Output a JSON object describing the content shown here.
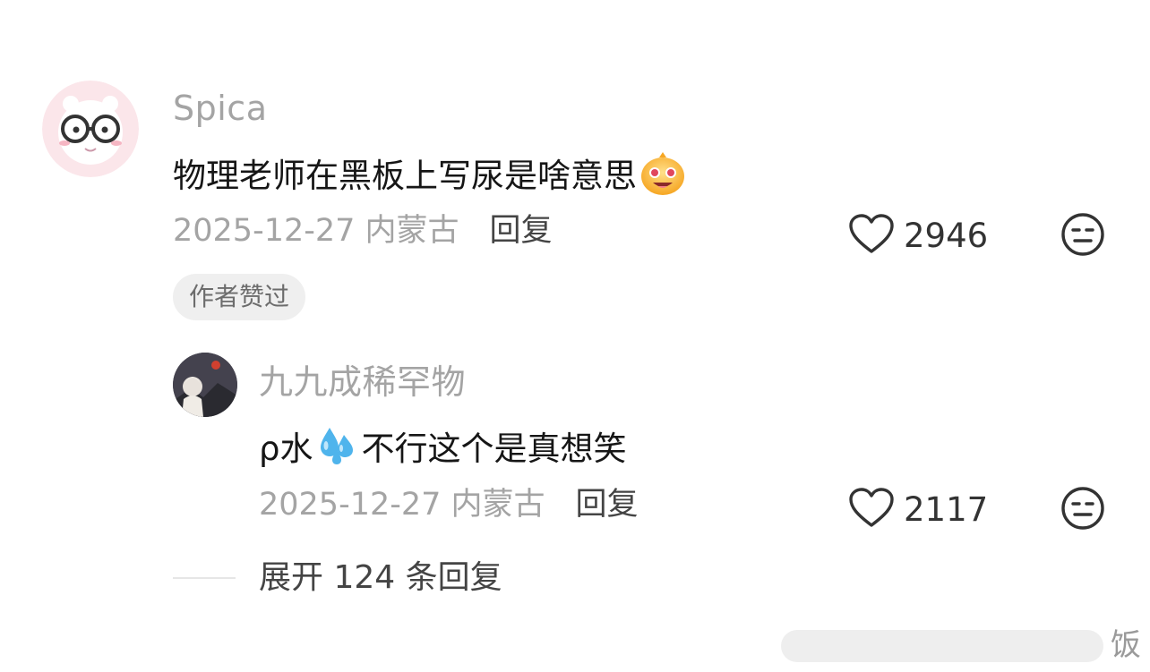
{
  "comment": {
    "username": "Spica",
    "text": "物理老师在黑板上写尿是啥意思",
    "emoji": "drooling-face-emoji",
    "date_location": "2025-12-27 内蒙古",
    "reply_label": "回复",
    "likes": "2946",
    "badge": "作者赞过"
  },
  "reply": {
    "username": "九九成稀罕物",
    "text_prefix": "ρ水",
    "emoji": "sweat-droplets-emoji",
    "text_suffix": "不行这个是真想笑",
    "date_location": "2025-12-27 内蒙古",
    "reply_label": "回复",
    "likes": "2117"
  },
  "expand": {
    "label": "展开 124 条回复"
  },
  "watermark": {
    "text": "饭"
  },
  "icons": {
    "like": "heart-outline-icon",
    "emoji_reaction": "neutral-face-icon"
  },
  "colors": {
    "username": "#a4a4a4",
    "text": "#161616",
    "meta": "#a4a4a4",
    "badge_bg": "#efefef"
  }
}
